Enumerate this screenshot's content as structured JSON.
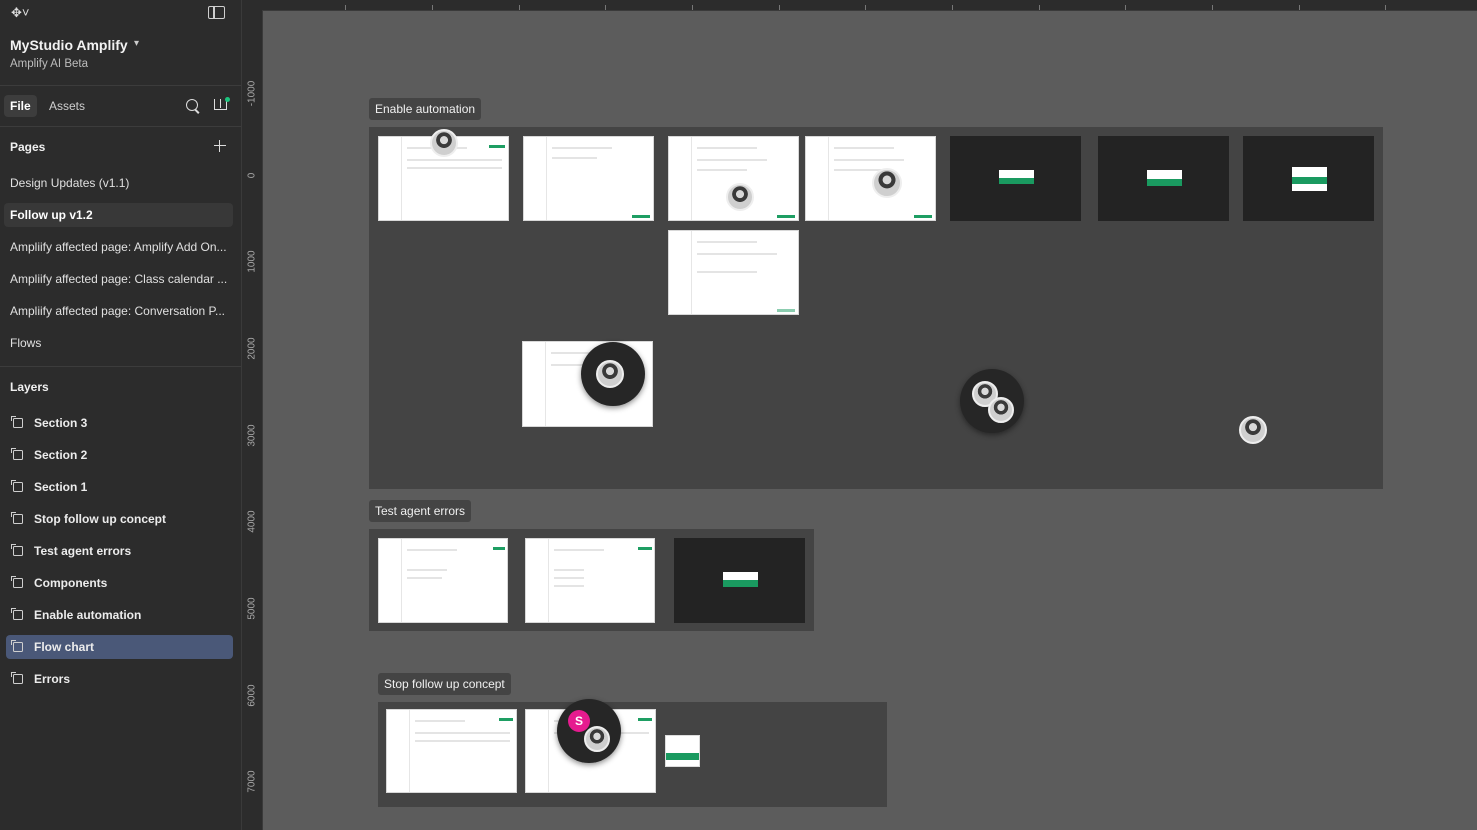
{
  "project": {
    "name": "MyStudio Amplify",
    "subtitle": "Amplify AI Beta"
  },
  "tabs": {
    "file": "File",
    "assets": "Assets"
  },
  "pages": {
    "title": "Pages",
    "items": [
      {
        "label": "Design Updates (v1.1)"
      },
      {
        "label": "Follow up v1.2"
      },
      {
        "label": "Ampliify affected page: Amplify Add On..."
      },
      {
        "label": "Ampliify affected page: Class calendar ..."
      },
      {
        "label": "Ampliify affected page:  Conversation P..."
      },
      {
        "label": "Flows"
      }
    ]
  },
  "layers": {
    "title": "Layers",
    "items": [
      {
        "label": "Section 3"
      },
      {
        "label": "Section 2"
      },
      {
        "label": "Section 1"
      },
      {
        "label": "Stop follow up concept"
      },
      {
        "label": "Test agent errors"
      },
      {
        "label": "Components"
      },
      {
        "label": "Enable automation"
      },
      {
        "label": "Flow chart"
      },
      {
        "label": "Errors"
      }
    ]
  },
  "ruler": {
    "vertical": [
      "-1000",
      "0",
      "1000",
      "2000",
      "3000",
      "4000",
      "5000",
      "6000",
      "7000"
    ]
  },
  "canvas": {
    "sections": [
      {
        "label": "Enable automation"
      },
      {
        "label": "Test agent errors"
      },
      {
        "label": "Stop follow up concept"
      }
    ],
    "badge_letter": "S"
  },
  "colors": {
    "accent_green": "#1e9e63",
    "selection": "#4a5878",
    "badge": "#e61b8f"
  }
}
